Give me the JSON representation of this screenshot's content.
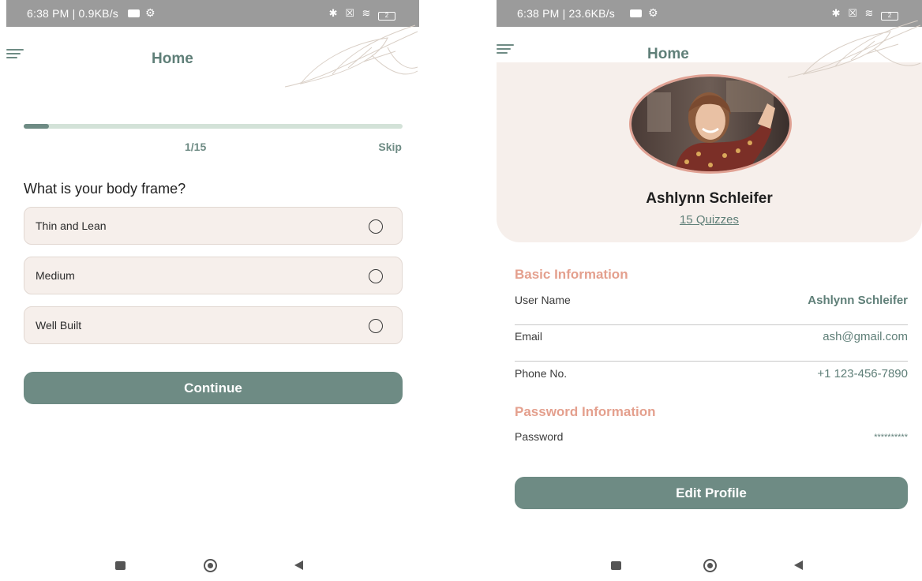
{
  "quiz_screen": {
    "status_time": "6:38 PM | 0.9KB/s",
    "title": "Home",
    "progress": {
      "current": 1,
      "total": 15,
      "fraction": 0.0667,
      "label": "1/15"
    },
    "skip_label": "Skip",
    "question": "What is your body frame?",
    "options": [
      {
        "label": "Thin and Lean"
      },
      {
        "label": "Medium"
      },
      {
        "label": "Well Built"
      }
    ],
    "continue_label": "Continue"
  },
  "profile_screen": {
    "status_time": "6:38 PM | 23.6KB/s",
    "title": "Home",
    "name": "Ashlynn Schleifer",
    "quiz_count": "15 Quizzes",
    "basic_info_title": "Basic Information",
    "basic_info": [
      {
        "label": "User Name",
        "value": "Ashlynn Schleifer"
      },
      {
        "label": "Email",
        "value": "ash@gmail.com"
      },
      {
        "label": "Phone No.",
        "value": "+1 123-456-7890"
      }
    ],
    "password_info_title": "Password Information",
    "password": {
      "label": "Password",
      "value": "**********"
    },
    "edit_label": "Edit Profile"
  },
  "status_icons": {
    "battery": "2"
  },
  "colors": {
    "primary": "#6e8b84",
    "accent": "#e4a08e",
    "card": "#f6efeb",
    "progress_track": "#d3e2d8"
  },
  "icons": [
    "menu-icon",
    "leaf-decoration",
    "radio-icon",
    "bluetooth-icon",
    "wifi-icon",
    "battery-icon",
    "recent-apps-icon",
    "home-icon",
    "back-icon"
  ]
}
